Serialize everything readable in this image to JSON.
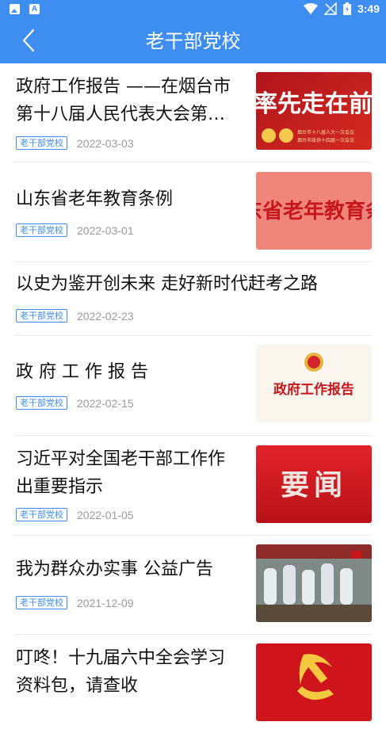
{
  "status_bar": {
    "time": "3:49"
  },
  "header": {
    "title": "老干部党校"
  },
  "articles": [
    {
      "title_line1": "政府工作报告 ——在烟台市",
      "title_line2": "第十八届人民代表大会第…",
      "tag": "老干部党校",
      "date": "2022-03-03",
      "thumb_text": "率先走在前",
      "thumb_caption_1": "烟台市十八届人大一次会议",
      "thumb_caption_2": "烟台市政协十四届一次会议"
    },
    {
      "title_line1": "山东省老年教育条例",
      "tag": "老干部党校",
      "date": "2022-03-01",
      "thumb_text": "东省老年教育条"
    },
    {
      "title_line1": "以史为鉴开创未来 走好新时代赶考之路",
      "tag": "老干部党校",
      "date": "2022-02-23"
    },
    {
      "title_line1": "政 府 工 作 报 告",
      "tag": "老干部党校",
      "date": "2022-02-15",
      "thumb_text": "政府工作报告"
    },
    {
      "title_line1": "习近平对全国老干部工作作",
      "title_line2": "出重要指示",
      "tag": "老干部党校",
      "date": "2022-01-05",
      "thumb_text": "要闻"
    },
    {
      "title_line1": "我为群众办实事 公益广告",
      "tag": "老干部党校",
      "date": "2021-12-09"
    },
    {
      "title_line1": "叮咚！十九届六中全会学习",
      "title_line2": "资料包，请查收"
    }
  ],
  "colors": {
    "primary": "#3d8ef0",
    "party_red": "#c8161d"
  }
}
